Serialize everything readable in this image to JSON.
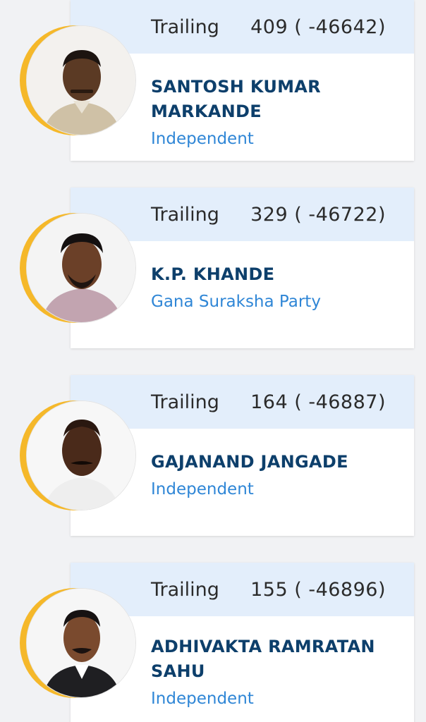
{
  "candidates": [
    {
      "status": "Trailing",
      "votes": "409 ( -46642)",
      "name": "SANTOSH KUMAR MARKANDE",
      "party": "Independent"
    },
    {
      "status": "Trailing",
      "votes": "329 ( -46722)",
      "name": "K.P. KHANDE",
      "party": "Gana Suraksha Party"
    },
    {
      "status": "Trailing",
      "votes": "164 ( -46887)",
      "name": "GAJANAND JANGADE",
      "party": "Independent"
    },
    {
      "status": "Trailing",
      "votes": "155 ( -46896)",
      "name": "ADHIVAKTA RAMRATAN SAHU",
      "party": "Independent"
    }
  ],
  "colors": {
    "header_bg": "#e3eefb",
    "name": "#0d3f6b",
    "party": "#2f86d6",
    "accent_arc": "#f5b82a"
  }
}
